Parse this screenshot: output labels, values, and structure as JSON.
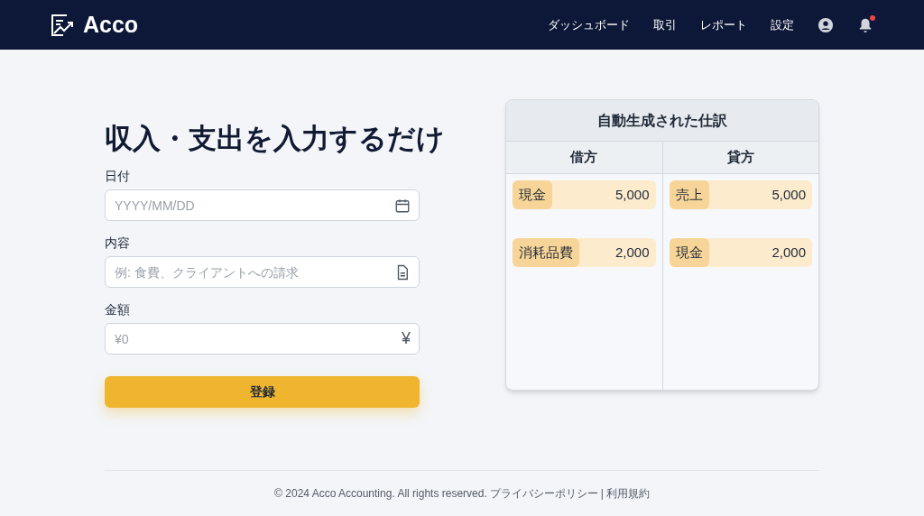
{
  "header": {
    "logo": "Acco",
    "nav": [
      "ダッシュボード",
      "取引",
      "レポート",
      "設定"
    ],
    "notification": true
  },
  "form": {
    "title": "収入・支出を入力するだけ",
    "fields": [
      {
        "kind": "date",
        "label": "日付",
        "placeholder": "YYYY/MM/DD"
      },
      {
        "kind": "text",
        "label": "内容",
        "placeholder": "例: 食費、クライアントへの請求"
      },
      {
        "kind": "amount",
        "label": "金額",
        "placeholder": "¥0",
        "symbol": "¥"
      }
    ],
    "submit": "登録"
  },
  "journal": {
    "title": "自動生成された仕訳",
    "columns": [
      {
        "heading": "借方",
        "entries": [
          {
            "account": "現金",
            "amount": "5,000"
          },
          {
            "account": "消耗品費",
            "amount": "2,000"
          }
        ]
      },
      {
        "heading": "貸方",
        "entries": [
          {
            "account": "売上",
            "amount": "5,000"
          },
          {
            "account": "現金",
            "amount": "2,000"
          }
        ]
      }
    ]
  },
  "footer": {
    "copyright": "© 2024 Acco Accounting. All rights reserved.",
    "links": [
      "プライバシーポリシー",
      "利用規約"
    ],
    "separator": "|"
  }
}
